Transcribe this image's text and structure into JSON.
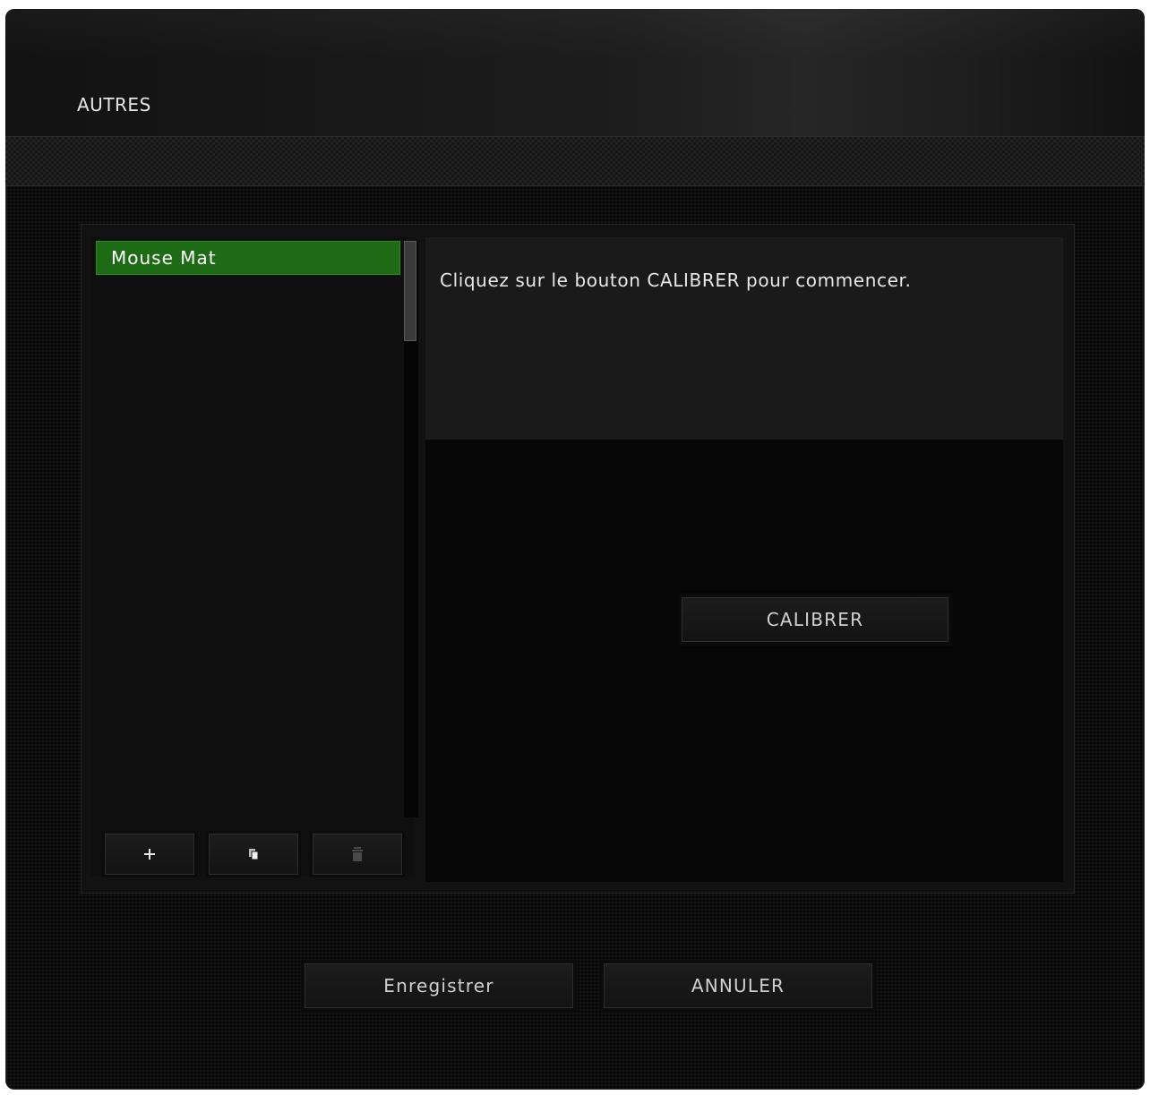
{
  "header": {
    "title": "AUTRES"
  },
  "profiles": {
    "items": [
      {
        "label": "Mouse Mat",
        "selected": true
      }
    ],
    "add_icon": "plus-icon",
    "copy_icon": "copy-icon",
    "delete_icon": "trash-icon"
  },
  "calibration": {
    "instruction": "Cliquez sur le bouton CALIBRER pour commencer.",
    "calibrate_label": "CALIBRER"
  },
  "footer": {
    "save_label": "Enregistrer",
    "cancel_label": "ANNULER"
  },
  "colors": {
    "accent_green": "#1d6b14",
    "background": "#0d0d0d"
  }
}
